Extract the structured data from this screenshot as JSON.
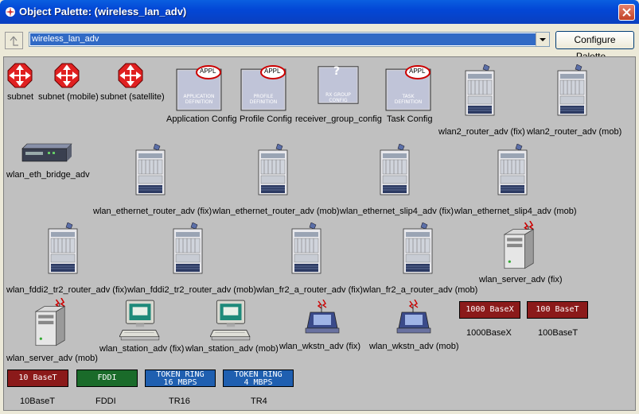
{
  "window": {
    "title": "Object Palette: (wireless_lan_adv)"
  },
  "toolbar": {
    "palette_value": "wireless_lan_adv",
    "configure_label": "Configure Palette..."
  },
  "colors": {
    "titlebar": "#0347d6",
    "panel": "#c0c0c0",
    "subnet_red": "#e02020",
    "link_red": "#8b1a1a",
    "link_green": "#1a6b2a",
    "link_blue": "#1f5fb0"
  },
  "items": {
    "subnet": "subnet",
    "subnet_mobile": "subnet (mobile)",
    "subnet_satellite": "subnet (satellite)",
    "app_config": "Application Config",
    "app_config_tag": "APPL",
    "app_config_icon_text": "APPLICATION DEFINITION",
    "profile_config": "Profile Config",
    "profile_config_tag": "APPL",
    "profile_config_icon_text": "PROFILE DEFINITION",
    "rx_config": "receiver_group_config",
    "rx_config_icon_text": "RX GROUP CONFIG",
    "task_config": "Task Config",
    "task_config_tag": "APPL",
    "task_config_icon_text": "TASK DEFINITION",
    "wlan2_router_fix": "wlan2_router_adv (fix)",
    "wlan2_router_mob": "wlan2_router_adv (mob)",
    "wlan_eth_bridge": "wlan_eth_bridge_adv",
    "wlan_ethernet_router_fix": "wlan_ethernet_router_adv (fix)",
    "wlan_ethernet_router_mob": "wlan_ethernet_router_adv (mob)",
    "wlan_ethernet_slip4_fix": "wlan_ethernet_slip4_adv (fix)",
    "wlan_ethernet_slip4_mob": "wlan_ethernet_slip4_adv (mob)",
    "wlan_fddi2_fix": "wlan_fddi2_tr2_router_adv (fix)",
    "wlan_fddi2_mob": "wlan_fddi2_tr2_router_adv (mob)",
    "wlan_fr2_fix": "wlan_fr2_a_router_adv (fix)",
    "wlan_fr2_mob": "wlan_fr2_a_router_adv (mob)",
    "wlan_server_fix": "wlan_server_adv (fix)",
    "wlan_server_mob": "wlan_server_adv (mob)",
    "wlan_station_fix": "wlan_station_adv (fix)",
    "wlan_station_mob": "wlan_station_adv (mob)",
    "wlan_wkstn_fix": "wlan_wkstn_adv (fix)",
    "wlan_wkstn_mob": "wlan_wkstn_adv (mob)",
    "link_1000basex": "1000BaseX",
    "link_1000basex_icon": "1000 BaseX",
    "link_100baset": "100BaseT",
    "link_100baset_icon": "100 BaseT",
    "link_10baset": "10BaseT",
    "link_10baset_icon": "10 BaseT",
    "link_fddi": "FDDI",
    "link_fddi_icon": "FDDI",
    "link_tr16": "TR16",
    "link_tr16_icon_line1": "TOKEN RING",
    "link_tr16_icon_line2": "16 MBPS",
    "link_tr4": "TR4",
    "link_tr4_icon_line1": "TOKEN RING",
    "link_tr4_icon_line2": "4 MBPS"
  }
}
